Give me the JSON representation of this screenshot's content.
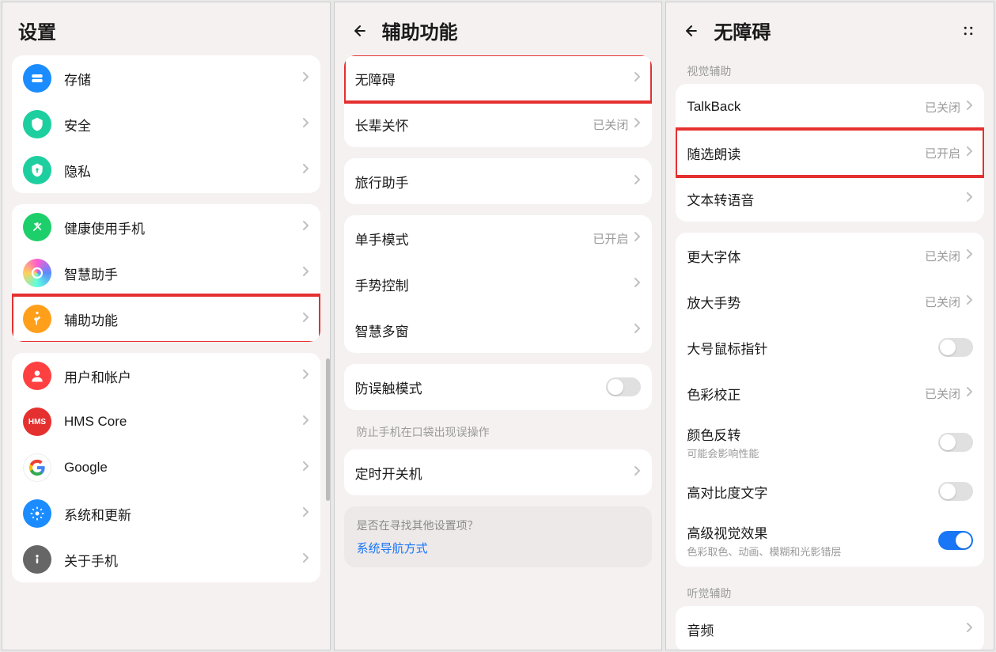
{
  "panel1": {
    "title": "设置",
    "groups": [
      [
        {
          "key": "storage",
          "label": "存储",
          "iconClass": "ic-storage"
        },
        {
          "key": "security",
          "label": "安全",
          "iconClass": "ic-security"
        },
        {
          "key": "privacy",
          "label": "隐私",
          "iconClass": "ic-privacy"
        }
      ],
      [
        {
          "key": "health",
          "label": "健康使用手机",
          "iconClass": "ic-health"
        },
        {
          "key": "ai",
          "label": "智慧助手",
          "iconClass": "ic-ai"
        },
        {
          "key": "accessibility",
          "label": "辅助功能",
          "iconClass": "ic-access",
          "highlight": true
        }
      ],
      [
        {
          "key": "users",
          "label": "用户和帐户",
          "iconClass": "ic-user"
        },
        {
          "key": "hms",
          "label": "HMS Core",
          "iconClass": "ic-hms",
          "iconText": "HMS"
        },
        {
          "key": "google",
          "label": "Google",
          "iconClass": "ic-google",
          "iconGoogle": true
        },
        {
          "key": "update",
          "label": "系统和更新",
          "iconClass": "ic-update"
        },
        {
          "key": "about",
          "label": "关于手机",
          "iconClass": "ic-about"
        }
      ]
    ]
  },
  "panel2": {
    "title": "辅助功能",
    "groups": [
      [
        {
          "key": "a11y",
          "label": "无障碍",
          "highlight": true
        },
        {
          "key": "elder",
          "label": "长辈关怀",
          "value": "已关闭"
        }
      ],
      [
        {
          "key": "travel",
          "label": "旅行助手"
        }
      ],
      [
        {
          "key": "onehand",
          "label": "单手模式",
          "value": "已开启"
        },
        {
          "key": "gesture",
          "label": "手势控制"
        },
        {
          "key": "multiwin",
          "label": "智慧多窗"
        }
      ],
      [
        {
          "key": "mistouch",
          "label": "防误触模式",
          "toggle": false
        }
      ]
    ],
    "mistouchNote": "防止手机在口袋出现误操作",
    "groups2": [
      [
        {
          "key": "schedule",
          "label": "定时开关机"
        }
      ]
    ],
    "hintQuestion": "是否在寻找其他设置项？",
    "hintLink": "系统导航方式"
  },
  "panel3": {
    "title": "无障碍",
    "section1Label": "视觉辅助",
    "groups1": [
      [
        {
          "key": "talkback",
          "label": "TalkBack",
          "value": "已关闭"
        },
        {
          "key": "select2speak",
          "label": "随选朗读",
          "value": "已开启",
          "highlight": true
        },
        {
          "key": "tts",
          "label": "文本转语音"
        }
      ]
    ],
    "groups2": [
      [
        {
          "key": "bigfont",
          "label": "更大字体",
          "value": "已关闭"
        },
        {
          "key": "magnify",
          "label": "放大手势",
          "value": "已关闭"
        },
        {
          "key": "bigcursor",
          "label": "大号鼠标指针",
          "toggle": false
        },
        {
          "key": "colorcorrect",
          "label": "色彩校正",
          "value": "已关闭"
        },
        {
          "key": "invert",
          "label": "颜色反转",
          "sublabel": "可能会影响性能",
          "toggle": false
        },
        {
          "key": "highcontrast",
          "label": "高对比度文字",
          "toggle": false
        },
        {
          "key": "visualfx",
          "label": "高级视觉效果",
          "sublabel": "色彩取色、动画、模糊和光影错层",
          "toggle": true
        }
      ]
    ],
    "section2Label": "听觉辅助",
    "groups3": [
      [
        {
          "key": "audio",
          "label": "音频"
        }
      ]
    ]
  }
}
